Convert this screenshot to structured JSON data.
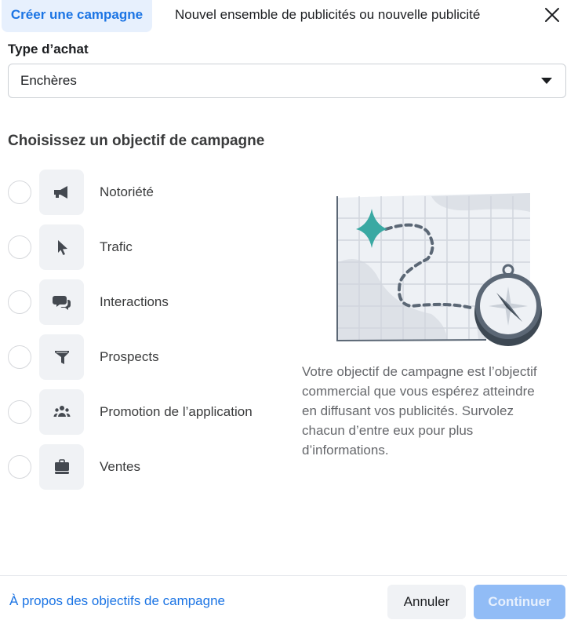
{
  "tabs": {
    "active": "Créer une campagne",
    "inactive": "Nouvel ensemble de publicités ou nouvelle publicité",
    "close_icon": "close-icon"
  },
  "purchase_type": {
    "label": "Type d’achat",
    "value": "Enchères"
  },
  "objectives": {
    "heading": "Choisissez un objectif de campagne",
    "items": [
      {
        "label": "Notoriété",
        "icon": "megaphone-icon",
        "selected": false
      },
      {
        "label": "Trafic",
        "icon": "cursor-icon",
        "selected": false
      },
      {
        "label": "Interactions",
        "icon": "chat-bubbles-icon",
        "selected": false
      },
      {
        "label": "Prospects",
        "icon": "funnel-icon",
        "selected": false
      },
      {
        "label": "Promotion de l’application",
        "icon": "people-icon",
        "selected": false
      },
      {
        "label": "Ventes",
        "icon": "briefcase-icon",
        "selected": false
      }
    ]
  },
  "description": "Votre objectif de campagne est l’objectif commercial que vous espérez atteindre en diffusant vos publicités. Survolez chacun d’entre eux pour plus d’informations.",
  "colors": {
    "accent": "#1b74e4",
    "tab_bg": "#e7f0fd",
    "illustration_teal": "#3aa9a3",
    "continue_disabled": "#91bcf6"
  },
  "footer": {
    "link": "À propos des objectifs de campagne",
    "cancel": "Annuler",
    "continue": "Continuer"
  }
}
